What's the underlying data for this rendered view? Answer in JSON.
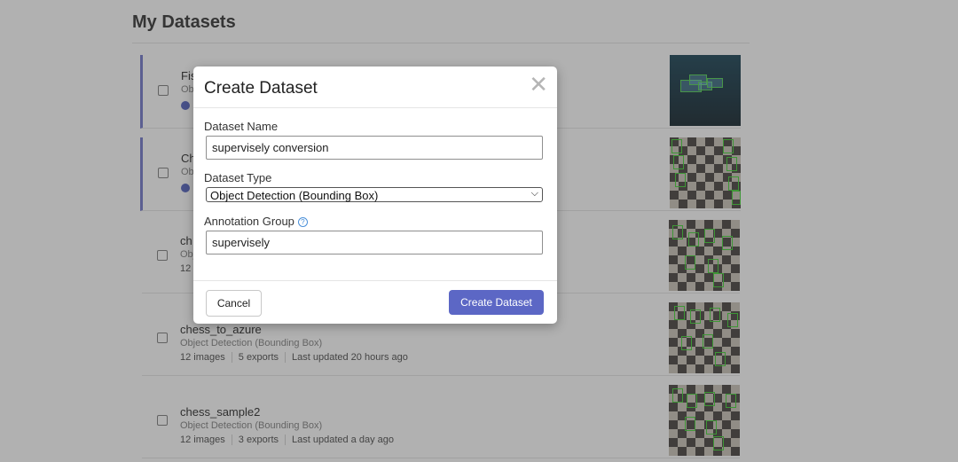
{
  "page": {
    "title": "My Datasets"
  },
  "datasets": [
    {
      "name": "Fis",
      "type": "Obj",
      "images": "",
      "exports": "",
      "updated": ""
    },
    {
      "name": "Ch",
      "type": "Ob",
      "images": "",
      "exports": "",
      "updated": ""
    },
    {
      "name": "ch",
      "type": "Obj",
      "images": "12",
      "exports": "",
      "updated": ""
    },
    {
      "name": "chess_to_azure",
      "type": "Object Detection (Bounding Box)",
      "images": "12 images",
      "exports": "5 exports",
      "updated": "Last updated 20 hours ago"
    },
    {
      "name": "chess_sample2",
      "type": "Object Detection (Bounding Box)",
      "images": "12 images",
      "exports": "3 exports",
      "updated": "Last updated a day ago"
    }
  ],
  "modal": {
    "title": "Create Dataset",
    "close_symbol": "✕",
    "name_label": "Dataset Name",
    "name_value": "supervisely conversion",
    "type_label": "Dataset Type",
    "type_value": "Object Detection (Bounding Box)",
    "group_label": "Annotation Group",
    "group_help": "?",
    "group_value": "supervisely",
    "cancel_label": "Cancel",
    "create_label": "Create Dataset"
  },
  "colors": {
    "accent": "#5c67c5",
    "bbox": "#39d12c",
    "selected_bar": "#6b72c9"
  },
  "icons": [
    "globe-icon",
    "close-icon",
    "help-icon",
    "chevron-down-icon"
  ]
}
